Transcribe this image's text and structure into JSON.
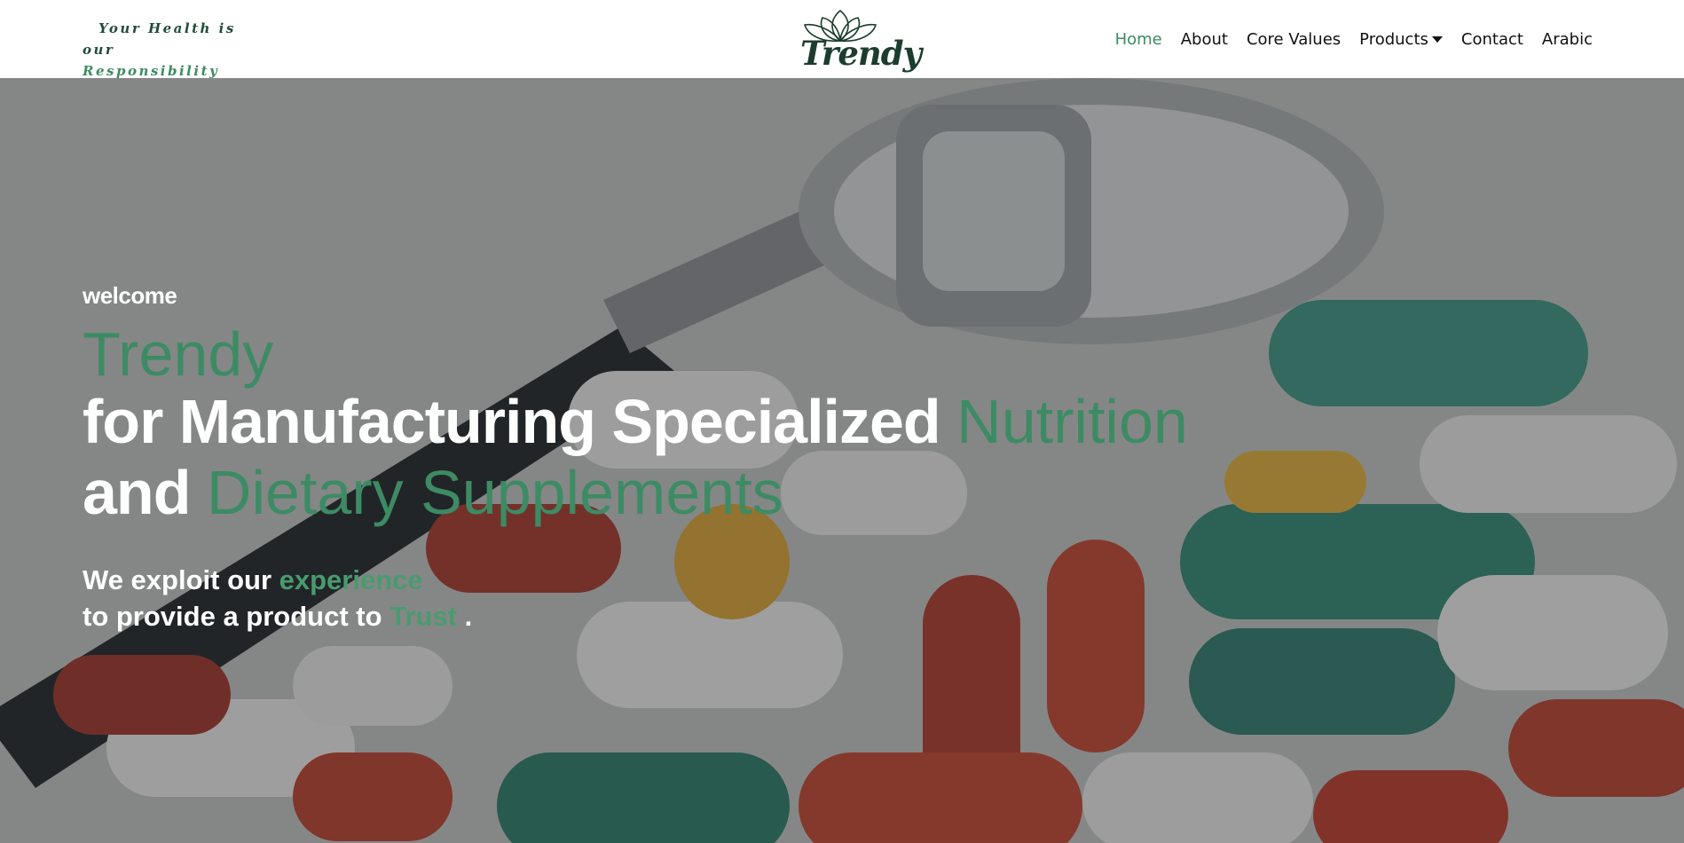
{
  "header": {
    "tagline_line1": "Your Health is",
    "tagline_line2_prefix": "our",
    "tagline_line2_rest": "Responsibility",
    "logo_text": "Trendy"
  },
  "nav": {
    "items": [
      {
        "label": "Home",
        "active": true
      },
      {
        "label": "About"
      },
      {
        "label": "Core Values"
      },
      {
        "label": "Products",
        "has_dropdown": true
      },
      {
        "label": "Contact"
      },
      {
        "label": "Arabic"
      }
    ]
  },
  "hero": {
    "welcome": "welcome",
    "brand": "Trendy",
    "headline_part1": "for Manufacturing Specialized",
    "headline_highlight1": "Nutrition",
    "headline_part2": "and",
    "headline_highlight2": "Dietary Supplements",
    "sub_line1_prefix": "We exploit our",
    "sub_line1_highlight": "experience",
    "sub_line2_prefix": "to provide a product to",
    "sub_line2_highlight": "Trust",
    "sub_line2_suffix": "."
  },
  "colors": {
    "accent": "#3d8b64",
    "dark_green": "#1c3d2e",
    "text": "#111111"
  },
  "icons": {
    "dropdown": "caret-down-icon",
    "logo": "lotus-logo"
  }
}
